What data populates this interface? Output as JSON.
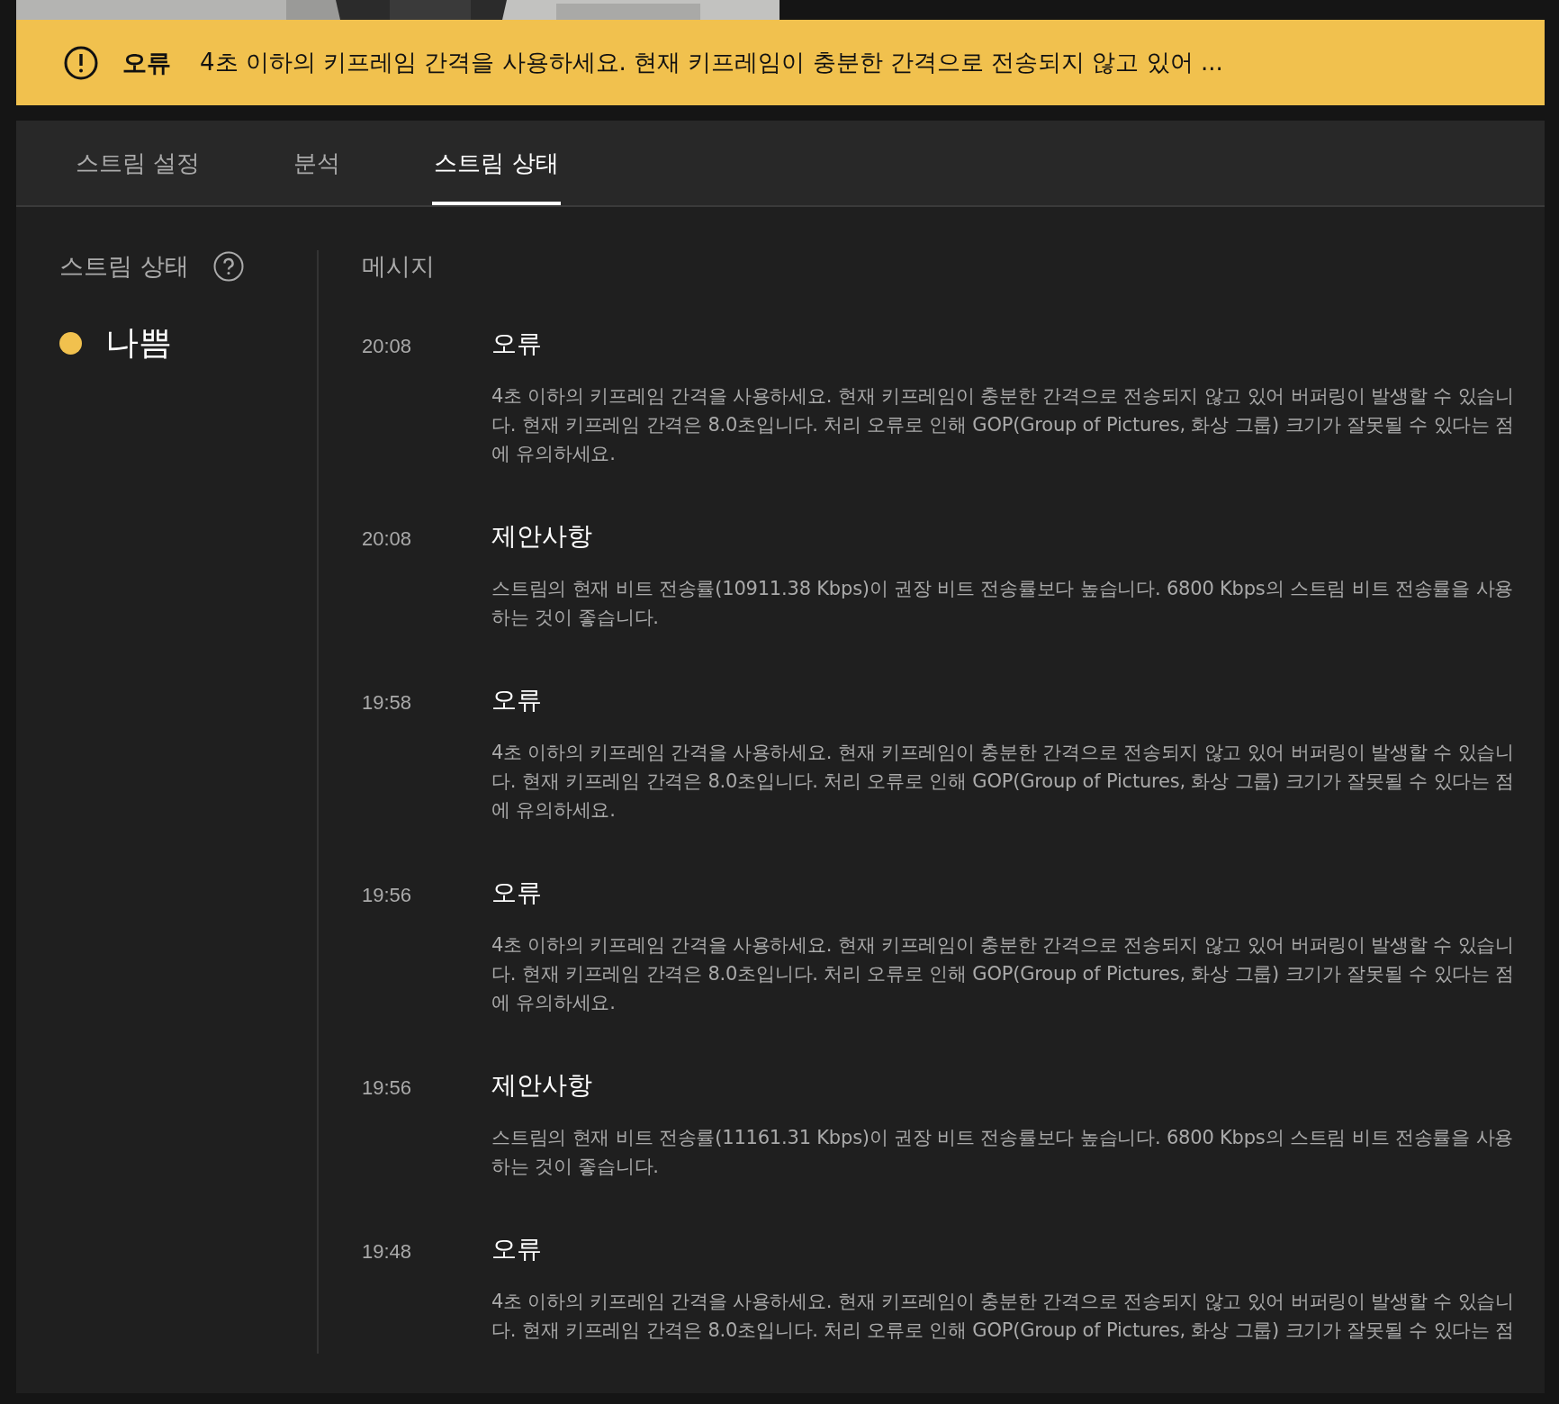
{
  "banner": {
    "severity": "오류",
    "message": "4초 이하의 키프레임 간격을 사용하세요. 현재 키프레임이 충분한 간격으로 전송되지 않고 있어 ..."
  },
  "tabs": [
    {
      "label": "스트림 설정",
      "selected": false
    },
    {
      "label": "분석",
      "selected": false
    },
    {
      "label": "스트림 상태",
      "selected": true
    }
  ],
  "status": {
    "heading": "스트림 상태",
    "value": "나쁨",
    "color": "#f1c14e"
  },
  "messages": {
    "heading": "메시지",
    "items": [
      {
        "time": "20:08",
        "title": "오류",
        "body": "4초 이하의 키프레임 간격을 사용하세요. 현재 키프레임이 충분한 간격으로 전송되지 않고 있어 버퍼링이 발생할 수 있습니다. 현재 키프레임 간격은 8.0초입니다. 처리 오류로 인해 GOP(Group of Pictures, 화상 그룹) 크기가 잘못될 수 있다는 점에 유의하세요."
      },
      {
        "time": "20:08",
        "title": "제안사항",
        "body": "스트림의 현재 비트 전송률(10911.38 Kbps)이 권장 비트 전송률보다 높습니다. 6800 Kbps의 스트림 비트 전송률을 사용하는 것이 좋습니다."
      },
      {
        "time": "19:58",
        "title": "오류",
        "body": "4초 이하의 키프레임 간격을 사용하세요. 현재 키프레임이 충분한 간격으로 전송되지 않고 있어 버퍼링이 발생할 수 있습니다. 현재 키프레임 간격은 8.0초입니다. 처리 오류로 인해 GOP(Group of Pictures, 화상 그룹) 크기가 잘못될 수 있다는 점에 유의하세요."
      },
      {
        "time": "19:56",
        "title": "오류",
        "body": "4초 이하의 키프레임 간격을 사용하세요. 현재 키프레임이 충분한 간격으로 전송되지 않고 있어 버퍼링이 발생할 수 있습니다. 현재 키프레임 간격은 8.0초입니다. 처리 오류로 인해 GOP(Group of Pictures, 화상 그룹) 크기가 잘못될 수 있다는 점에 유의하세요."
      },
      {
        "time": "19:56",
        "title": "제안사항",
        "body": "스트림의 현재 비트 전송률(11161.31 Kbps)이 권장 비트 전송률보다 높습니다. 6800 Kbps의 스트림 비트 전송률을 사용하는 것이 좋습니다."
      },
      {
        "time": "19:48",
        "title": "오류",
        "body": "4초 이하의 키프레임 간격을 사용하세요. 현재 키프레임이 충분한 간격으로 전송되지 않고 있어 버퍼링이 발생할 수 있습니다. 현재 키프레임 간격은 8.0초입니다. 처리 오류로 인해 GOP(Group of Pictures, 화상 그룹) 크기가 잘못될 수 있다는 점"
      }
    ]
  }
}
